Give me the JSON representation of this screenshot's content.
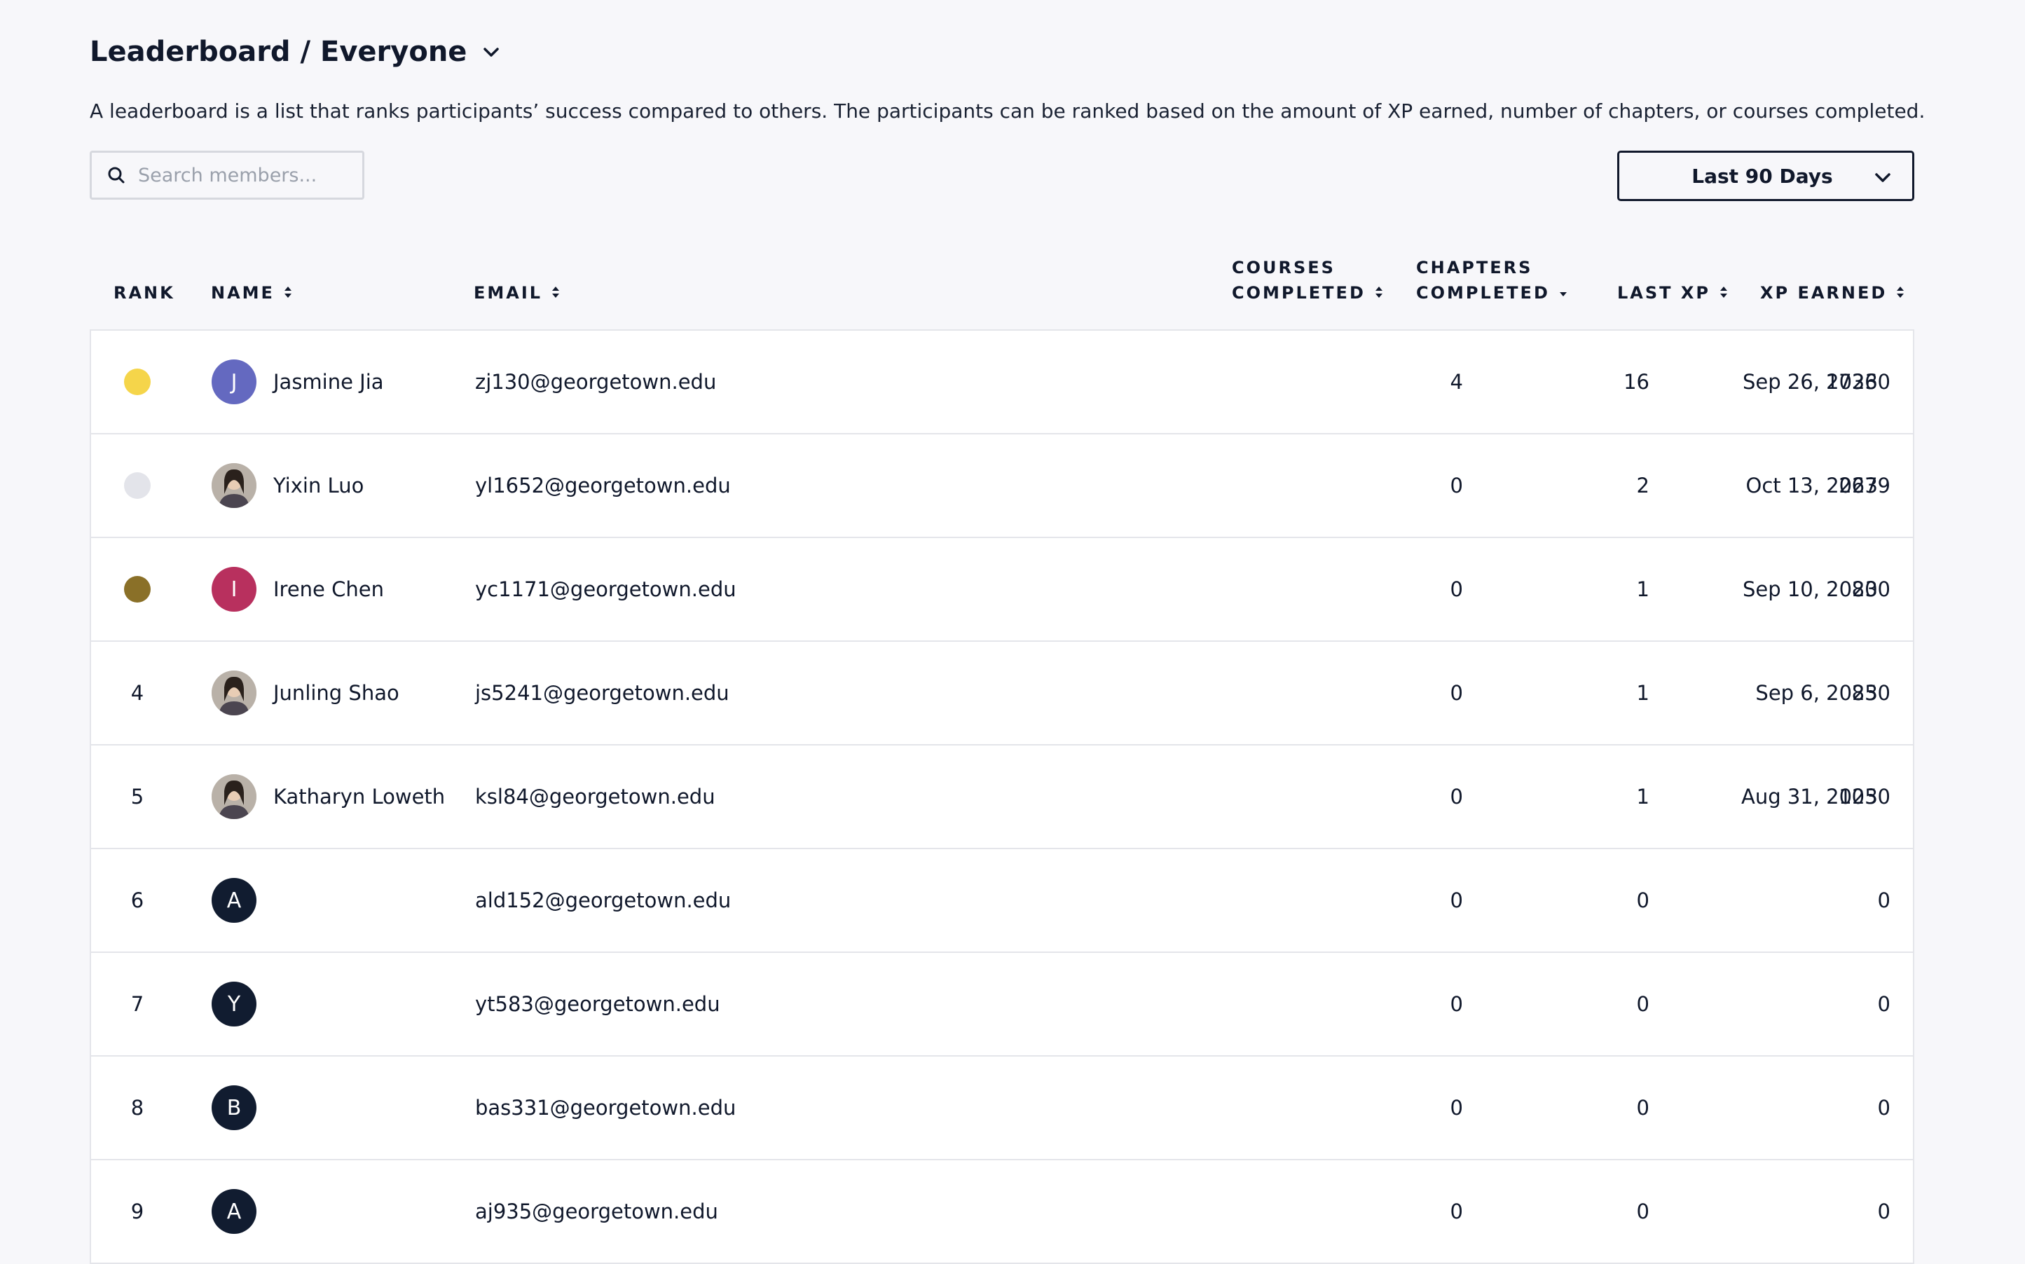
{
  "header": {
    "title": "Leaderboard / Everyone",
    "description": "A leaderboard is a list that ranks participants’ success compared to others. The participants can be ranked based on the amount of XP earned, number of chapters, or courses completed."
  },
  "search": {
    "placeholder": "Search members...",
    "value": ""
  },
  "period": {
    "label": "Last 90 Days"
  },
  "columns": {
    "rank": "RANK",
    "name": "NAME",
    "email": "EMAIL",
    "courses_1": "COURSES",
    "courses_2": "COMPLETED",
    "chapters_1": "CHAPTERS",
    "chapters_2": "COMPLETED",
    "last_xp": "LAST XP",
    "xp_earned": "XP EARNED"
  },
  "colors": {
    "gold": "#f5d54a",
    "silver": "#e3e4ea",
    "bronze": "#8a7028",
    "avatar_purple": "#6469c0",
    "avatar_magenta": "#b8305e",
    "avatar_navy": "#111c30"
  },
  "rows": [
    {
      "rank": "",
      "medal": "gold",
      "initial": "J",
      "avatar_color": "#6469c0",
      "photo": false,
      "name": "Jasmine Jia",
      "email": "zj130@georgetown.edu",
      "courses": "4",
      "chapters": "16",
      "last_xp": "Sep 26, 2023",
      "xp": "17360"
    },
    {
      "rank": "",
      "medal": "silver",
      "initial": "",
      "avatar_color": "",
      "photo": true,
      "name": "Yixin Luo",
      "email": "yl1652@georgetown.edu",
      "courses": "0",
      "chapters": "2",
      "last_xp": "Oct 13, 2023",
      "xp": "2679"
    },
    {
      "rank": "",
      "medal": "bronze",
      "initial": "I",
      "avatar_color": "#b8305e",
      "photo": false,
      "name": "Irene Chen",
      "email": "yc1171@georgetown.edu",
      "courses": "0",
      "chapters": "1",
      "last_xp": "Sep 10, 2023",
      "xp": "800"
    },
    {
      "rank": "4",
      "medal": "",
      "initial": "",
      "avatar_color": "",
      "photo": true,
      "name": "Junling Shao",
      "email": "js5241@georgetown.edu",
      "courses": "0",
      "chapters": "1",
      "last_xp": "Sep 6, 2023",
      "xp": "850"
    },
    {
      "rank": "5",
      "medal": "",
      "initial": "",
      "avatar_color": "",
      "photo": true,
      "name": "Katharyn Loweth",
      "email": "ksl84@georgetown.edu",
      "courses": "0",
      "chapters": "1",
      "last_xp": "Aug 31, 2023",
      "xp": "1050"
    },
    {
      "rank": "6",
      "medal": "",
      "initial": "A",
      "avatar_color": "#111c30",
      "photo": false,
      "name": "",
      "email": "ald152@georgetown.edu",
      "courses": "0",
      "chapters": "0",
      "last_xp": "",
      "xp": "0"
    },
    {
      "rank": "7",
      "medal": "",
      "initial": "Y",
      "avatar_color": "#111c30",
      "photo": false,
      "name": "",
      "email": "yt583@georgetown.edu",
      "courses": "0",
      "chapters": "0",
      "last_xp": "",
      "xp": "0"
    },
    {
      "rank": "8",
      "medal": "",
      "initial": "B",
      "avatar_color": "#111c30",
      "photo": false,
      "name": "",
      "email": "bas331@georgetown.edu",
      "courses": "0",
      "chapters": "0",
      "last_xp": "",
      "xp": "0"
    },
    {
      "rank": "9",
      "medal": "",
      "initial": "A",
      "avatar_color": "#111c30",
      "photo": false,
      "name": "",
      "email": "aj935@georgetown.edu",
      "courses": "0",
      "chapters": "0",
      "last_xp": "",
      "xp": "0"
    }
  ]
}
